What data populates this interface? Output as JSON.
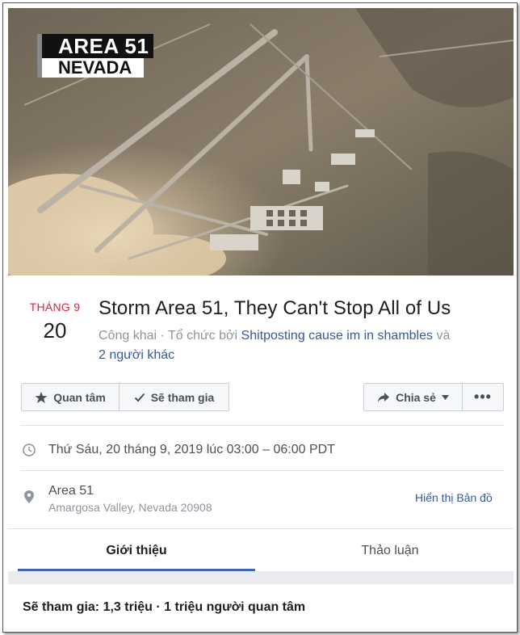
{
  "cover": {
    "badge_line1": "AREA 51",
    "badge_line2": "NEVADA"
  },
  "event": {
    "month": "THÁNG 9",
    "day": "20",
    "title": "Storm Area 51, They Can't Stop All of Us",
    "privacy": "Công khai",
    "organized_by_prefix": " · Tổ chức bởi ",
    "organizer": "Shitposting cause im in shambles",
    "and": " và",
    "others": "2 người khác"
  },
  "actions": {
    "interested_label": "Quan tâm",
    "going_label": "Sẽ tham gia",
    "share_label": "Chia sẻ",
    "more_label": "•••"
  },
  "details": {
    "datetime": "Thứ Sáu, 20 tháng 9, 2019 lúc 03:00 – 06:00 PDT",
    "place_name": "Area 51",
    "place_address": "Amargosa Valley, Nevada 20908",
    "show_map_label": "Hiển thị Bản đồ"
  },
  "tabs": [
    {
      "label": "Giới thiệu",
      "active": true
    },
    {
      "label": "Thảo luận",
      "active": false
    }
  ],
  "stats": {
    "text": "Sẽ tham gia: 1,3 triệu · 1 triệu người quan tâm"
  },
  "colors": {
    "month_red": "#e41e3f",
    "link_blue": "#365899",
    "tab_underline": "#4267b2"
  }
}
